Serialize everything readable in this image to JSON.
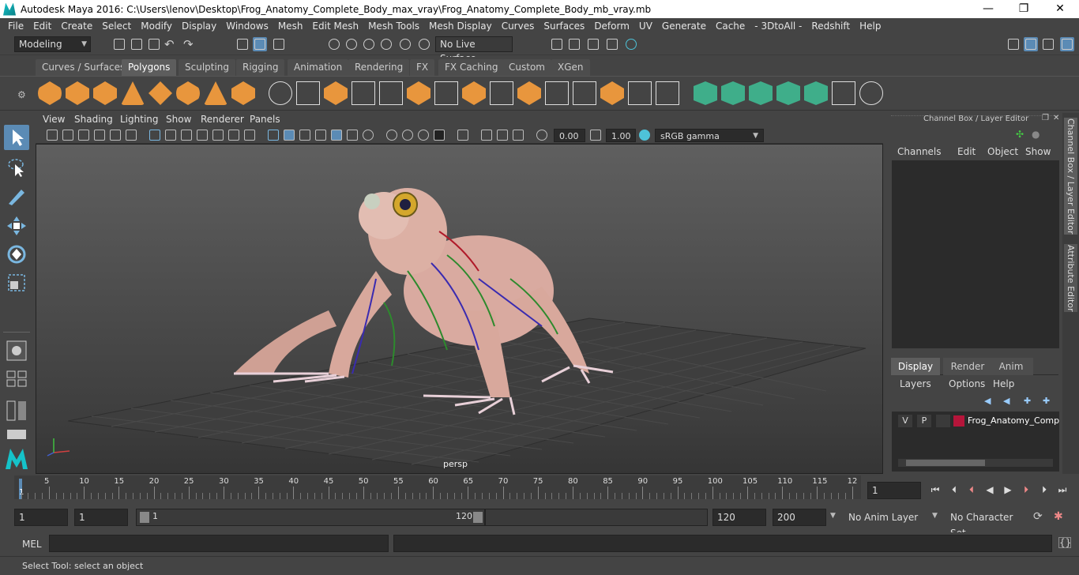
{
  "window": {
    "title": "Autodesk Maya 2016: C:\\Users\\lenov\\Desktop\\Frog_Anatomy_Complete_Body_max_vray\\Frog_Anatomy_Complete_Body_mb_vray.mb",
    "minimize": "—",
    "maximize": "❐",
    "close": "✕"
  },
  "menubar": [
    "File",
    "Edit",
    "Create",
    "Select",
    "Modify",
    "Display",
    "Windows",
    "Mesh",
    "Edit Mesh",
    "Mesh Tools",
    "Mesh Display",
    "Curves",
    "Surfaces",
    "Deform",
    "UV",
    "Generate",
    "Cache",
    "- 3DtoAll -",
    "Redshift",
    "Help"
  ],
  "statusline": {
    "mode": "Modeling",
    "live_surface": "No Live Surface"
  },
  "shelf_tabs": [
    "Curves / Surfaces",
    "Polygons",
    "Sculpting",
    "Rigging",
    "Animation",
    "Rendering",
    "FX",
    "FX Caching",
    "Custom",
    "XGen"
  ],
  "active_shelf_tab": "Polygons",
  "viewport": {
    "menu": [
      "View",
      "Shading",
      "Lighting",
      "Show",
      "Renderer",
      "Panels"
    ],
    "exposure": "0.00",
    "gamma": "1.00",
    "color_space": "sRGB gamma",
    "camera_label": "persp"
  },
  "channelbox": {
    "title": "Channel Box / Layer Editor",
    "menu": [
      "Channels",
      "Edit",
      "Object",
      "Show"
    ],
    "layer_tabs": [
      "Display",
      "Render",
      "Anim"
    ],
    "active_layer_tab": "Display",
    "layer_menu": [
      "Layers",
      "Options",
      "Help"
    ],
    "layer": {
      "v": "V",
      "p": "P",
      "name": "Frog_Anatomy_Compl",
      "color": "#b5153a"
    }
  },
  "side_tabs": [
    "Channel Box / Layer Editor",
    "Attribute Editor"
  ],
  "timeline": {
    "ticks": [
      "5",
      "10",
      "15",
      "20",
      "25",
      "30",
      "35",
      "40",
      "45",
      "50",
      "55",
      "60",
      "65",
      "70",
      "75",
      "80",
      "85",
      "90",
      "95",
      "100",
      "105",
      "110",
      "115",
      "12"
    ],
    "start_label": "1",
    "current_frame": "1"
  },
  "range": {
    "start": "1",
    "playback_start": "1",
    "slider_start": "1",
    "slider_end": "120",
    "playback_end": "120",
    "end": "200",
    "anim_layer": "No Anim Layer",
    "character_set": "No Character Set"
  },
  "cmdline": {
    "label": "MEL"
  },
  "helpline": {
    "text": "Select Tool: select an object"
  },
  "colors": {
    "accent": "#5b8bb5",
    "shelf_orange": "#e8963d",
    "shelf_green": "#3fae8a"
  }
}
